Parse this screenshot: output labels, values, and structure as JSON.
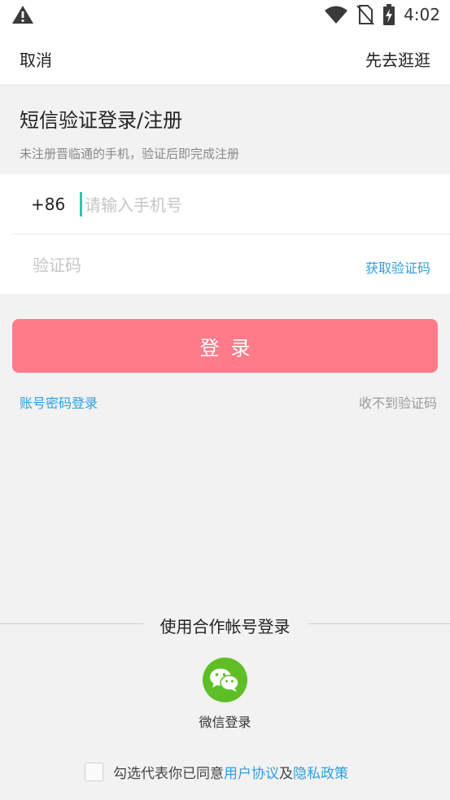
{
  "status_bar": {
    "time": "4:02",
    "icons": [
      "warning-icon",
      "wifi-icon",
      "no-sim-icon",
      "battery-charging-icon"
    ]
  },
  "top_bar": {
    "cancel_label": "取消",
    "browse_label": "先去逛逛"
  },
  "heading": {
    "title": "短信验证登录/注册",
    "subtitle": "未注册晋临通的手机，验证后即完成注册"
  },
  "form": {
    "country_code": "+86",
    "phone_placeholder": "请输入手机号",
    "code_placeholder": "验证码",
    "get_code_label": "获取验证码"
  },
  "login": {
    "button_label": "登录",
    "password_login_label": "账号密码登录",
    "no_code_label": "收不到验证码"
  },
  "partner": {
    "title": "使用合作帐号登录",
    "wechat_label": "微信登录"
  },
  "agreement": {
    "prefix": "勾选代表你已同意",
    "user_agreement": "用户协议",
    "and": "及",
    "privacy_policy": "隐私政策"
  },
  "colors": {
    "accent_pink": "#ff7b8a",
    "link_blue": "#2f9ee0",
    "wechat_green": "#5dbf25",
    "cursor_teal": "#29c7a9"
  }
}
